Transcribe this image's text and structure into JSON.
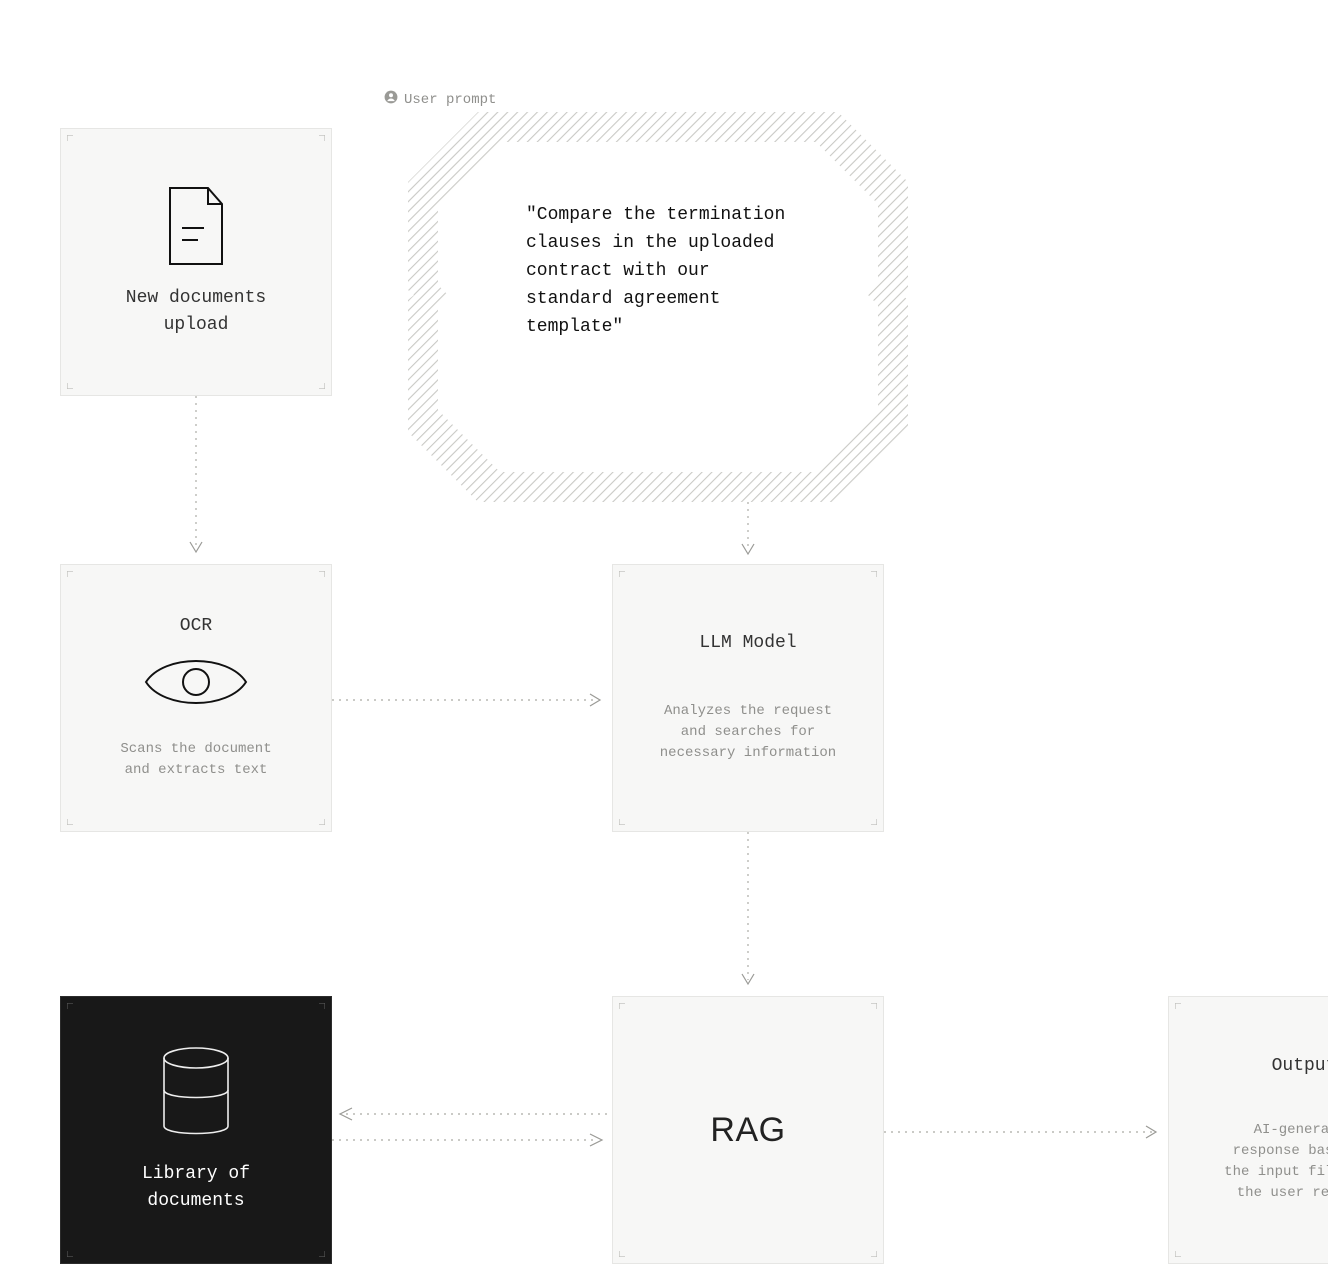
{
  "prompt": {
    "label": "User prompt",
    "text": "\"Compare the termination clauses in the uploaded contract with our standard agreement template\""
  },
  "upload": {
    "title": "New documents\nupload"
  },
  "ocr": {
    "title": "OCR",
    "desc": "Scans the document\nand extracts text"
  },
  "llm": {
    "title": "LLM Model",
    "desc": "Analyzes the request\nand searches for\nnecessary information"
  },
  "library": {
    "title": "Library of\ndocuments"
  },
  "rag": {
    "title": "RAG"
  },
  "output": {
    "title": "Output",
    "desc": "AI-generated\nresponse based on\nthe input files and\nthe user request"
  }
}
